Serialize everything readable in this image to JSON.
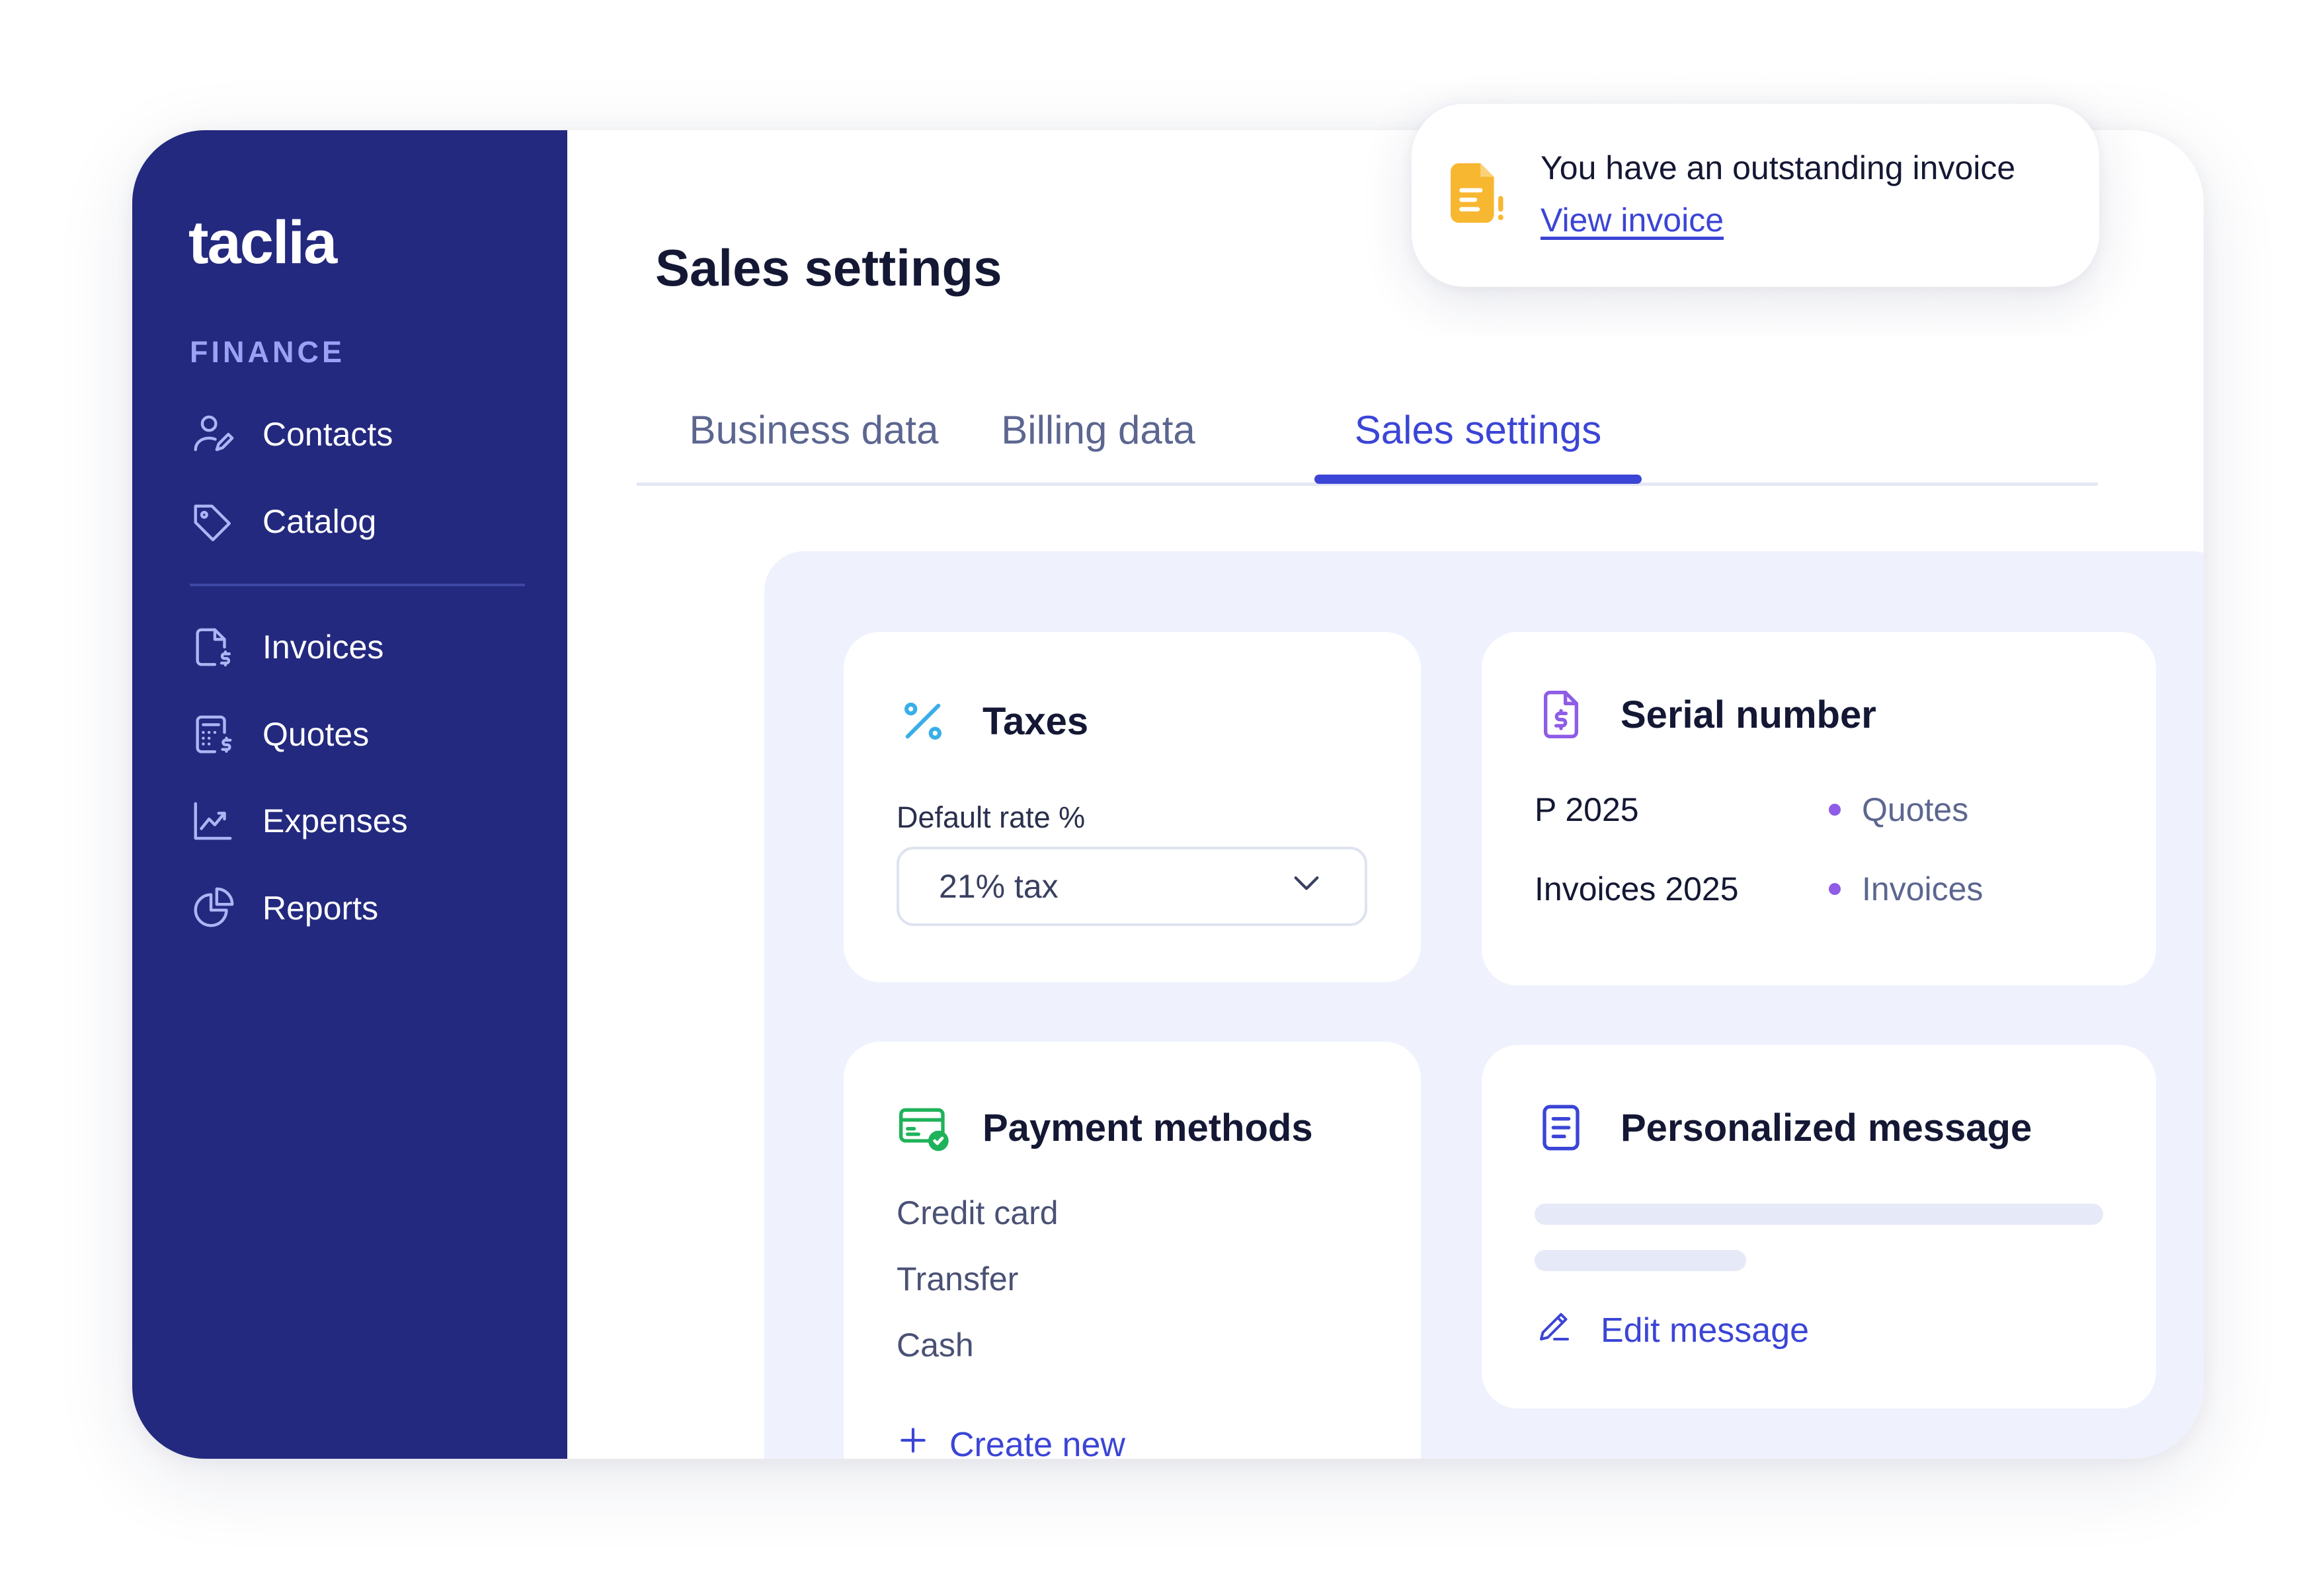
{
  "app": {
    "logo": "taclia"
  },
  "sidebar": {
    "section_label": "FINANCE",
    "items": [
      {
        "label": "Contacts",
        "icon": "user-edit-icon"
      },
      {
        "label": "Catalog",
        "icon": "tag-icon"
      },
      {
        "label": "Invoices",
        "icon": "invoice-icon"
      },
      {
        "label": "Quotes",
        "icon": "calculator-icon"
      },
      {
        "label": "Expenses",
        "icon": "trend-chart-icon"
      },
      {
        "label": "Reports",
        "icon": "pie-chart-icon"
      }
    ]
  },
  "header": {
    "title": "Sales settings"
  },
  "tabs": [
    {
      "label": "Business data",
      "active": false
    },
    {
      "label": "Billing data",
      "active": false
    },
    {
      "label": "Sales settings",
      "active": true
    }
  ],
  "taxes": {
    "title": "Taxes",
    "icon": "percent-icon",
    "field_label": "Default rate %",
    "selected_value": "21% tax"
  },
  "serial": {
    "title": "Serial number",
    "icon": "document-dollar-icon",
    "rows": [
      {
        "value": "P 2025",
        "tag": "Quotes"
      },
      {
        "value": "Invoices 2025",
        "tag": "Invoices"
      }
    ]
  },
  "payment": {
    "title": "Payment methods",
    "icon": "card-check-icon",
    "methods": [
      "Credit card",
      "Transfer",
      "Cash"
    ],
    "create_label": "Create new"
  },
  "message": {
    "title": "Personalized message",
    "icon": "document-lines-icon",
    "edit_label": "Edit message"
  },
  "toast": {
    "text": "You have an outstanding invoice",
    "link": "View invoice",
    "icon": "file-alert-icon"
  },
  "colors": {
    "sidebar": "#23297f",
    "accent": "#3b45d6",
    "panel": "#eff2fd",
    "percent_icon": "#3aaee8",
    "serial_icon": "#8e5ce6",
    "payment_icon": "#1fb25a",
    "toast_icon": "#f7b731"
  }
}
